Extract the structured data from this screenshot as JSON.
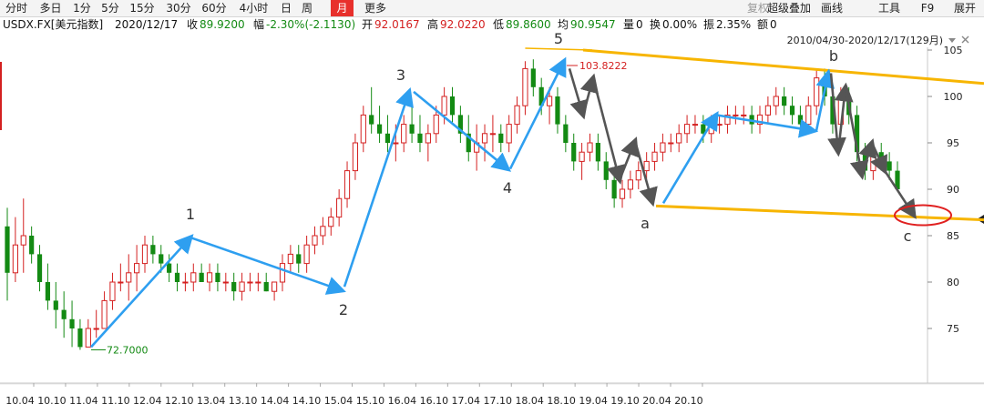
{
  "toolbar": {
    "periods": [
      "分时",
      "多日",
      "1分",
      "5分",
      "15分",
      "30分",
      "60分",
      "4小时",
      "日",
      "周",
      "月",
      "更多"
    ],
    "active_period": "月",
    "right_items": [
      "复权",
      "超级叠加",
      "画线",
      "工具",
      "F9",
      "展开"
    ]
  },
  "info": {
    "symbol": "USDX.FX[美元指数]",
    "date": "2020/12/17",
    "close_label": "收",
    "close": "89.9200",
    "change_label": "幅",
    "change": "-2.30%(-2.1130)",
    "open_label": "开",
    "open": "92.0167",
    "high_label": "高",
    "high": "92.0220",
    "low_label": "低",
    "low": "89.8600",
    "avg_label": "均",
    "avg": "90.9547",
    "volume_label": "量",
    "volume": "0",
    "turnover_label": "换",
    "turnover": "0.00%",
    "amplitude_label": "振",
    "amplitude": "2.35%",
    "amount_label": "额",
    "amount": "0",
    "range": "2010/04/30-2020/12/17(129月)"
  },
  "colors": {
    "up": "#d42020",
    "down": "#138a13",
    "arrow_blue": "#2e9ff0",
    "arrow_gray": "#555555",
    "channel": "#f7b500",
    "circle": "#e02020"
  },
  "chart_data": {
    "type": "candlestick",
    "ylim": [
      72,
      105.5
    ],
    "yticks": [
      75,
      80,
      85,
      90,
      95,
      100,
      105
    ],
    "xtick_labels": [
      "10.04",
      "10.10",
      "11.04",
      "11.10",
      "12.04",
      "12.10",
      "13.04",
      "13.10",
      "14.04",
      "14.10",
      "15.04",
      "15.10",
      "16.04",
      "16.10",
      "17.04",
      "17.10",
      "18.04",
      "18.10",
      "19.04",
      "19.10",
      "20.04",
      "20.10"
    ],
    "annotations": {
      "max_label": "103.8222",
      "max_value": 103.8222,
      "min_label": "72.7000",
      "min_value": 72.7,
      "waves": [
        "1",
        "2",
        "3",
        "4",
        "5",
        "a",
        "b",
        "c"
      ]
    },
    "candles": [
      [
        86,
        88,
        78,
        81
      ],
      [
        81,
        87,
        80,
        84
      ],
      [
        84,
        89,
        81,
        85
      ],
      [
        85,
        86,
        82,
        83
      ],
      [
        83,
        84,
        79,
        80
      ],
      [
        80,
        82,
        77,
        78
      ],
      [
        78,
        80,
        75,
        77
      ],
      [
        77,
        79,
        74,
        76
      ],
      [
        76,
        78,
        73,
        75
      ],
      [
        75,
        76,
        72.7,
        73
      ],
      [
        73,
        76,
        73,
        75
      ],
      [
        75,
        77,
        74,
        75
      ],
      [
        75,
        79,
        75,
        78
      ],
      [
        78,
        81,
        77,
        80
      ],
      [
        80,
        82,
        79,
        80
      ],
      [
        80,
        83,
        78,
        81
      ],
      [
        81,
        84,
        79,
        82
      ],
      [
        82,
        85,
        81,
        84
      ],
      [
        84,
        85,
        82,
        83
      ],
      [
        83,
        84,
        81,
        82
      ],
      [
        82,
        83,
        80,
        81
      ],
      [
        81,
        82,
        79,
        80
      ],
      [
        80,
        81,
        79,
        80
      ],
      [
        80,
        82,
        79,
        81
      ],
      [
        81,
        82,
        80,
        80
      ],
      [
        80,
        82,
        79,
        81
      ],
      [
        81,
        82,
        79,
        80
      ],
      [
        80,
        81,
        79,
        80
      ],
      [
        80,
        81,
        78,
        79
      ],
      [
        79,
        81,
        78,
        80
      ],
      [
        80,
        81,
        79,
        80
      ],
      [
        80,
        81,
        79,
        80
      ],
      [
        80,
        81,
        79,
        79
      ],
      [
        79,
        80,
        78,
        80
      ],
      [
        80,
        83,
        79,
        82
      ],
      [
        82,
        84,
        81,
        83
      ],
      [
        83,
        84,
        81,
        82
      ],
      [
        82,
        85,
        81,
        84
      ],
      [
        84,
        86,
        83,
        85
      ],
      [
        85,
        87,
        84,
        86
      ],
      [
        86,
        88,
        85,
        87
      ],
      [
        87,
        90,
        86,
        89
      ],
      [
        89,
        93,
        88,
        92
      ],
      [
        92,
        96,
        91,
        95
      ],
      [
        95,
        99,
        94,
        98
      ],
      [
        98,
        101,
        96,
        97
      ],
      [
        97,
        99,
        95,
        96
      ],
      [
        96,
        98,
        94,
        95
      ],
      [
        95,
        97,
        93,
        95
      ],
      [
        95,
        98,
        94,
        97
      ],
      [
        97,
        99,
        95,
        96
      ],
      [
        96,
        98,
        94,
        95
      ],
      [
        95,
        97,
        93,
        96
      ],
      [
        96,
        99,
        95,
        98
      ],
      [
        98,
        101,
        97,
        100
      ],
      [
        100,
        101,
        97,
        98
      ],
      [
        98,
        99,
        95,
        96
      ],
      [
        96,
        98,
        93,
        94
      ],
      [
        94,
        97,
        92,
        95
      ],
      [
        95,
        97,
        93,
        96
      ],
      [
        96,
        98,
        94,
        96
      ],
      [
        96,
        97,
        94,
        95
      ],
      [
        95,
        98,
        94,
        97
      ],
      [
        97,
        100,
        96,
        99
      ],
      [
        99,
        103.8,
        98,
        103
      ],
      [
        103,
        104,
        100,
        101
      ],
      [
        101,
        102,
        98,
        99
      ],
      [
        99,
        101,
        97,
        100
      ],
      [
        100,
        101,
        96,
        97
      ],
      [
        97,
        98,
        94,
        95
      ],
      [
        95,
        96,
        92,
        93
      ],
      [
        93,
        95,
        91,
        94
      ],
      [
        94,
        96,
        93,
        95
      ],
      [
        95,
        96,
        92,
        93
      ],
      [
        93,
        94,
        90,
        91
      ],
      [
        91,
        92,
        88,
        89
      ],
      [
        89,
        91,
        88,
        90
      ],
      [
        90,
        92,
        89,
        91
      ],
      [
        91,
        93,
        90,
        92
      ],
      [
        92,
        94,
        91,
        93
      ],
      [
        93,
        95,
        92,
        94
      ],
      [
        94,
        96,
        93,
        95
      ],
      [
        95,
        96,
        94,
        95
      ],
      [
        95,
        97,
        94,
        96
      ],
      [
        96,
        98,
        95,
        97
      ],
      [
        97,
        98,
        96,
        97
      ],
      [
        97,
        98,
        95,
        96
      ],
      [
        96,
        98,
        95,
        97
      ],
      [
        97,
        98,
        96,
        97
      ],
      [
        97,
        99,
        96,
        98
      ],
      [
        98,
        99,
        97,
        98
      ],
      [
        98,
        99,
        97,
        98
      ],
      [
        98,
        99,
        96,
        97
      ],
      [
        97,
        99,
        96,
        98
      ],
      [
        98,
        100,
        97,
        99
      ],
      [
        99,
        101,
        98,
        100
      ],
      [
        100,
        101,
        98,
        99
      ],
      [
        99,
        100,
        97,
        98
      ],
      [
        98,
        99,
        96,
        97
      ],
      [
        97,
        100,
        96,
        99
      ],
      [
        99,
        103,
        98,
        102
      ],
      [
        102,
        103,
        99,
        100
      ],
      [
        100,
        101,
        96,
        97
      ],
      [
        97,
        101,
        96,
        100
      ],
      [
        100,
        101,
        97,
        98
      ],
      [
        98,
        99,
        93,
        94
      ],
      [
        94,
        95,
        91,
        92
      ],
      [
        92,
        95,
        91,
        94
      ],
      [
        94,
        95,
        92,
        93
      ],
      [
        93,
        94,
        91,
        92
      ],
      [
        92,
        93,
        89.9,
        90
      ]
    ]
  }
}
